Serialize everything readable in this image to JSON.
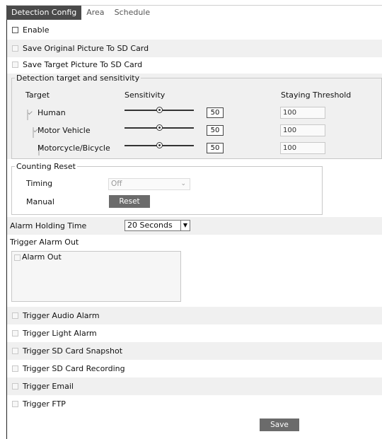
{
  "tabs": [
    "Detection Config",
    "Area",
    "Schedule"
  ],
  "enable_label": "Enable",
  "save_original_label": "Save Original Picture To SD Card",
  "save_target_label": "Save Target Picture To SD Card",
  "detection": {
    "legend": "Detection target and sensitivity",
    "headers": {
      "target": "Target",
      "sensitivity": "Sensitivity",
      "threshold": "Staying Threshold"
    },
    "rows": [
      {
        "target": "Human",
        "sensitivity": "50",
        "threshold": "100",
        "level": 0.5
      },
      {
        "target": "Motor Vehicle",
        "sensitivity": "50",
        "threshold": "100",
        "level": 0.5
      },
      {
        "target": "Motorcycle/Bicycle",
        "sensitivity": "50",
        "threshold": "100",
        "level": 0.5
      }
    ]
  },
  "counting": {
    "legend": "Counting Reset",
    "timing_label": "Timing",
    "timing_value": "Off",
    "manual_label": "Manual",
    "reset_button": "Reset"
  },
  "alarm_holding": {
    "label": "Alarm Holding Time",
    "value": "20 Seconds"
  },
  "trigger_alarm_out_label": "Trigger Alarm Out",
  "alarm_out_label": "Alarm Out",
  "triggers": [
    "Trigger Audio Alarm",
    "Trigger Light Alarm",
    "Trigger SD Card Snapshot",
    "Trigger SD Card Recording",
    "Trigger Email",
    "Trigger FTP"
  ],
  "save_button": "Save",
  "colors": {
    "tab_active_bg": "#4a4a4a",
    "row_alt_bg": "#f0f0f0",
    "button_bg": "#6b6b6b"
  }
}
